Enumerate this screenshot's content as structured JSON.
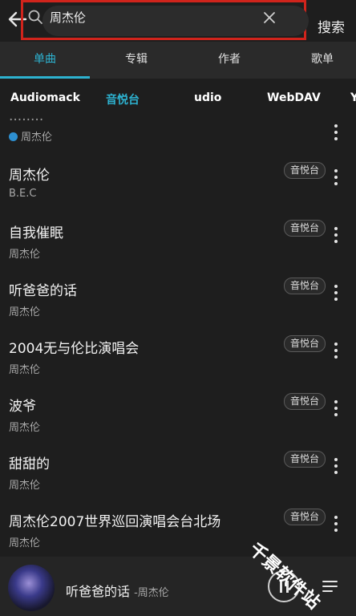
{
  "header": {
    "back_icon": "back-arrow-icon",
    "search_icon": "search-icon",
    "search_value": "周杰伦",
    "clear_icon": "close-icon",
    "search_button": "搜索",
    "highlight_color": "#d0241c"
  },
  "tabs": [
    {
      "label": "单曲",
      "active": true
    },
    {
      "label": "专辑",
      "active": false
    },
    {
      "label": "作者",
      "active": false
    },
    {
      "label": "歌单",
      "active": false
    }
  ],
  "sources": [
    {
      "label": "Audiomack",
      "active": false
    },
    {
      "label": "音悦台",
      "active": true
    },
    {
      "label": "udio",
      "active": false
    },
    {
      "label": "WebDAV",
      "active": false
    },
    {
      "label": "Y",
      "active": false
    }
  ],
  "partial_row": {
    "artist": "周杰伦",
    "verified_icon": "verified-icon"
  },
  "songs": [
    {
      "title": "周杰伦",
      "artist": "B.E.C",
      "badge": "音悦台"
    },
    {
      "title": "自我催眠",
      "artist": "周杰伦",
      "badge": "音悦台"
    },
    {
      "title": "听爸爸的话",
      "artist": "周杰伦",
      "badge": "音悦台"
    },
    {
      "title": "2004无与伦比演唱会",
      "artist": "周杰伦",
      "badge": "音悦台"
    },
    {
      "title": "波爷",
      "artist": "周杰伦",
      "badge": "音悦台"
    },
    {
      "title": "甜甜的",
      "artist": "周杰伦",
      "badge": "音悦台"
    },
    {
      "title": "周杰伦2007世界巡回演唱会台北场",
      "artist": "周杰伦",
      "badge": "音悦台"
    }
  ],
  "player": {
    "title": "听爸爸的话",
    "artist": "-周杰伦",
    "play_icon": "pause-icon",
    "queue_icon": "playlist-icon"
  },
  "watermark": "千景软件站",
  "colors": {
    "accent": "#2db2d0",
    "background": "#1e1e1e",
    "tab_bar": "#2a2a2a"
  }
}
